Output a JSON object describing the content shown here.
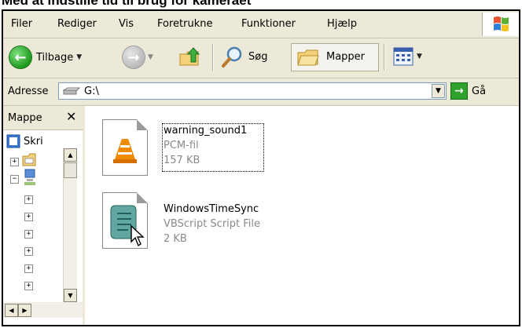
{
  "caption": "Med at indstille tid til brug for kameraet",
  "menu": [
    "Filer",
    "Rediger",
    "Vis",
    "Foretrukne",
    "Funktioner",
    "Hjælp"
  ],
  "toolbar": {
    "back_label": "Tilbage",
    "search_label": "Søg",
    "folders_label": "Mapper"
  },
  "address": {
    "label": "Adresse",
    "value": "G:\\",
    "go_label": "Gå"
  },
  "sidebar": {
    "title": "Mappe",
    "root_label": "Skri"
  },
  "files": [
    {
      "name": "warning_sound1",
      "type": "PCM-fil",
      "size": "157 KB",
      "icon": "vlc-cone-icon"
    },
    {
      "name": "WindowsTimeSync",
      "type": "VBScript Script File",
      "size": "2 KB",
      "icon": "script-scroll-icon"
    }
  ],
  "colors": {
    "xp_face": "#ece9d8",
    "go_green": "#2ca12c",
    "vlc_orange": "#f08a00",
    "script_teal": "#5fa7a0"
  }
}
